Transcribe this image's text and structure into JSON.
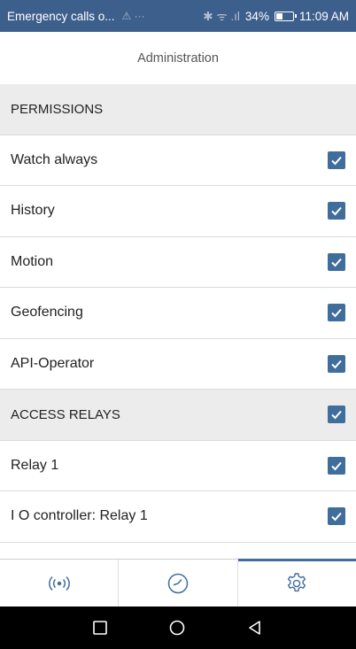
{
  "status_bar": {
    "notification": "Emergency calls o...",
    "notif_icons": "⚠ ···",
    "signal_glyphs": "✱ ᯤ .ıl",
    "battery_percent": "34%",
    "battery_level": 0.34,
    "time": "11:09 AM"
  },
  "header": {
    "title": "Administration"
  },
  "list": {
    "permissions_header": "PERMISSIONS",
    "items": [
      {
        "label": "Watch always",
        "checked": true
      },
      {
        "label": "History",
        "checked": true
      },
      {
        "label": "Motion",
        "checked": true
      },
      {
        "label": "Geofencing",
        "checked": true
      },
      {
        "label": "API-Operator",
        "checked": true
      }
    ],
    "access_relays_header": "ACCESS RELAYS",
    "access_relays_checked": true,
    "relays": [
      {
        "label": "Relay 1",
        "checked": true
      },
      {
        "label": "I O controller: Relay 1",
        "checked": true
      }
    ]
  },
  "bottom_nav": {
    "tabs": [
      {
        "icon": "broadcast-icon",
        "active": false
      },
      {
        "icon": "clock-icon",
        "active": false
      },
      {
        "icon": "gear-icon",
        "active": true
      }
    ]
  },
  "system_nav": {
    "icons": [
      "square-icon",
      "circle-icon",
      "back-triangle-icon"
    ]
  },
  "colors": {
    "status_bar": "#3d5f8c",
    "accent": "#3f6d9c",
    "section_bg": "#ececec"
  }
}
